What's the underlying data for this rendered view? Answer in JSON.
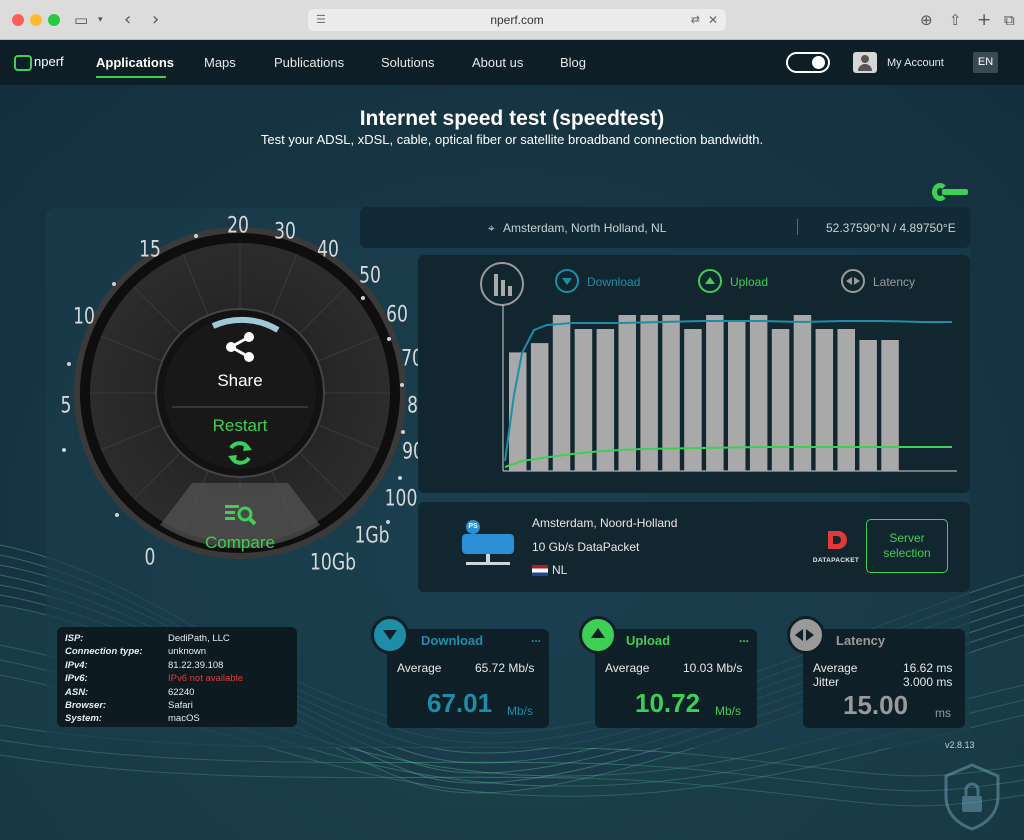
{
  "browser": {
    "url": "nperf.com"
  },
  "nav": {
    "logo": "nperf",
    "items": [
      "Applications",
      "Maps",
      "Publications",
      "Solutions",
      "About us",
      "Blog"
    ],
    "account": "My Account",
    "lang": "EN"
  },
  "header": {
    "title": "Internet speed test (speedtest)",
    "subtitle": "Test your ADSL, xDSL, cable, optical fiber or satellite broadband connection bandwidth."
  },
  "location": {
    "place": "Amsterdam, North Holland, NL",
    "coords": "52.37590°N / 4.89750°E"
  },
  "gauge": {
    "ticks": [
      "0",
      "5",
      "10",
      "15",
      "20",
      "30",
      "40",
      "50",
      "60",
      "70",
      "80",
      "90",
      "100",
      "1Gb",
      "10Gb"
    ],
    "share": "Share",
    "restart": "Restart",
    "compare": "Compare"
  },
  "legend": {
    "download": "Download",
    "upload": "Upload",
    "latency": "Latency"
  },
  "chart_data": {
    "type": "bar",
    "bars": [
      76,
      82,
      100,
      91,
      91,
      100,
      100,
      100,
      91,
      100,
      96,
      100,
      91,
      100,
      91,
      91,
      84,
      84
    ],
    "download_line": "rises to ~97 and plateaus",
    "upload_line": "rises to ~15 and plateaus",
    "series": [
      {
        "name": "Download"
      },
      {
        "name": "Upload"
      },
      {
        "name": "Latency"
      }
    ]
  },
  "server": {
    "city": "Amsterdam, Noord-Holland",
    "provider": "10 Gb/s DataPacket",
    "country": "NL",
    "brand": "DATAPACKET",
    "button": "Server selection",
    "badge": "PS"
  },
  "isp": {
    "rows": [
      [
        "ISP:",
        "DediPath, LLC"
      ],
      [
        "Connection type:",
        "unknown"
      ],
      [
        "IPv4:",
        "81.22.39.108"
      ],
      [
        "IPv6:",
        "IPv6 not available"
      ],
      [
        "ASN:",
        "62240"
      ],
      [
        "Browser:",
        "Safari"
      ],
      [
        "System:",
        "macOS"
      ]
    ]
  },
  "results": {
    "download": {
      "title": "Download",
      "avg_label": "Average",
      "avg": "65.72 Mb/s",
      "value": "67.01",
      "unit": "Mb/s",
      "more": "..."
    },
    "upload": {
      "title": "Upload",
      "avg_label": "Average",
      "avg": "10.03 Mb/s",
      "value": "10.72",
      "unit": "Mb/s",
      "more": "..."
    },
    "latency": {
      "title": "Latency",
      "avg_label": "Average",
      "avg": "16.62 ms",
      "jitter_label": "Jitter",
      "jitter": "3.000 ms",
      "value": "15.00",
      "unit": "ms"
    }
  },
  "version": "v2.8.13",
  "colors": {
    "download": "#1e8ea8",
    "upload": "#3ecf55",
    "latency": "#9a9a9a",
    "bars": "#a9a9a9"
  }
}
